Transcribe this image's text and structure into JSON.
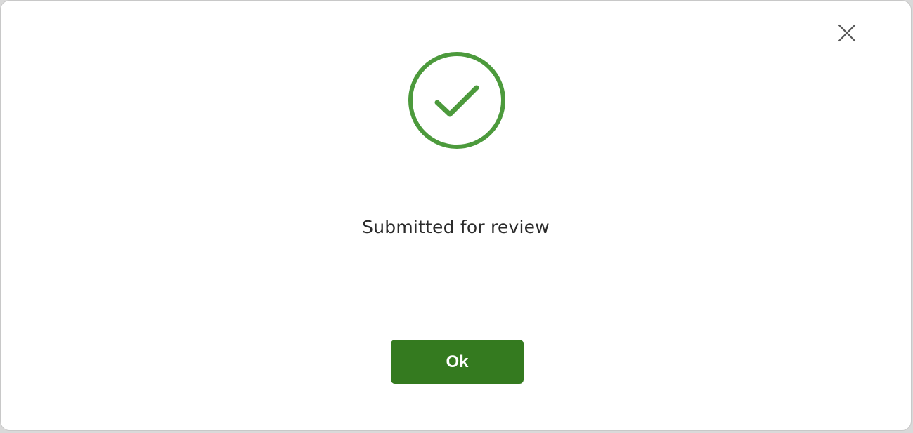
{
  "dialog": {
    "message": "Submitted for review",
    "ok_label": "Ok",
    "close_icon": "close-icon",
    "status_icon": "check-circle-icon"
  },
  "colors": {
    "success_green": "#4c9a3c",
    "button_green": "#347a1f",
    "button_text": "#ffffff",
    "message_text": "#2b2b2b",
    "close_icon": "#555555"
  }
}
